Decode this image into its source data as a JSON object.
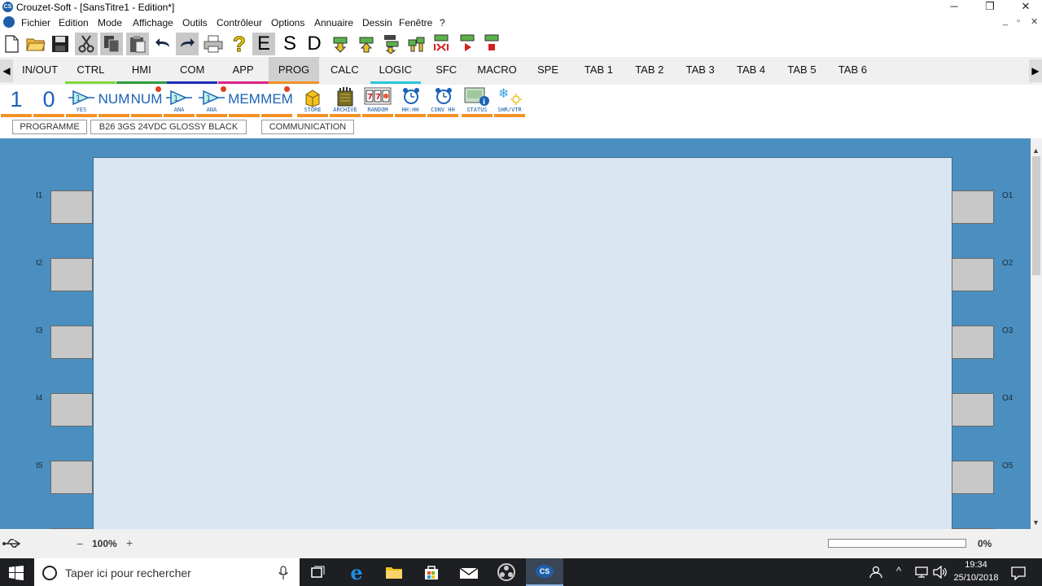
{
  "window": {
    "title": "Crouzet-Soft - [SansTitre1 - Edition*]",
    "app_icon": "CS"
  },
  "menu": {
    "items": [
      "Fichier",
      "Edition",
      "Mode",
      "Affichage",
      "Outils",
      "Contrôleur",
      "Options",
      "Annuaire",
      "Dessin",
      "Fenêtre",
      "?"
    ]
  },
  "toolbar": {
    "letter_e": "E",
    "letter_s": "S",
    "letter_d": "D"
  },
  "tabs": [
    {
      "label": "IN/OUT",
      "color": ""
    },
    {
      "label": "CTRL",
      "color": "#7fd83a"
    },
    {
      "label": "HMI",
      "color": "#2f9e3f"
    },
    {
      "label": "COM",
      "color": "#1b2fb8"
    },
    {
      "label": "APP",
      "color": "#e0218a"
    },
    {
      "label": "PROG",
      "color": "#f39226",
      "active": true
    },
    {
      "label": "CALC",
      "color": ""
    },
    {
      "label": "LOGIC",
      "color": "#29c6d6"
    },
    {
      "label": "SFC",
      "color": ""
    },
    {
      "label": "MACRO",
      "color": ""
    },
    {
      "label": "SPE",
      "color": ""
    },
    {
      "label": "TAB 1",
      "color": ""
    },
    {
      "label": "TAB 2",
      "color": ""
    },
    {
      "label": "TAB 3",
      "color": ""
    },
    {
      "label": "TAB 4",
      "color": ""
    },
    {
      "label": "TAB 5",
      "color": ""
    },
    {
      "label": "TAB 6",
      "color": ""
    }
  ],
  "palette": {
    "one": "1",
    "zero": "0",
    "yes": "YES",
    "num1": "NUM",
    "num2": "NUM",
    "ana1": "ANA",
    "ana2": "ANA",
    "mem1": "MEM",
    "mem2": "MEM",
    "store": "STORE",
    "archive": "ARCHIVE",
    "random": "RANDOM",
    "hhhh": "HH:HH",
    "convhh": "CONV HH",
    "status": "STATUS",
    "shrvtr": "SHR/VTR"
  },
  "subbar": {
    "programme": "PROGRAMME",
    "model": "B26 3GS 24VDC GLOSSY BLACK",
    "communication": "COMMUNICATION"
  },
  "inputs": [
    "I1",
    "I2",
    "I3",
    "I4",
    "I5"
  ],
  "outputs": [
    "O1",
    "O2",
    "O3",
    "O4",
    "O5"
  ],
  "status": {
    "zoom_minus": "−",
    "zoom": "100%",
    "zoom_plus": "+",
    "progress": "0%"
  },
  "taskbar": {
    "search_placeholder": "Taper ici pour rechercher",
    "time": "19:34",
    "date": "25/10/2018"
  }
}
